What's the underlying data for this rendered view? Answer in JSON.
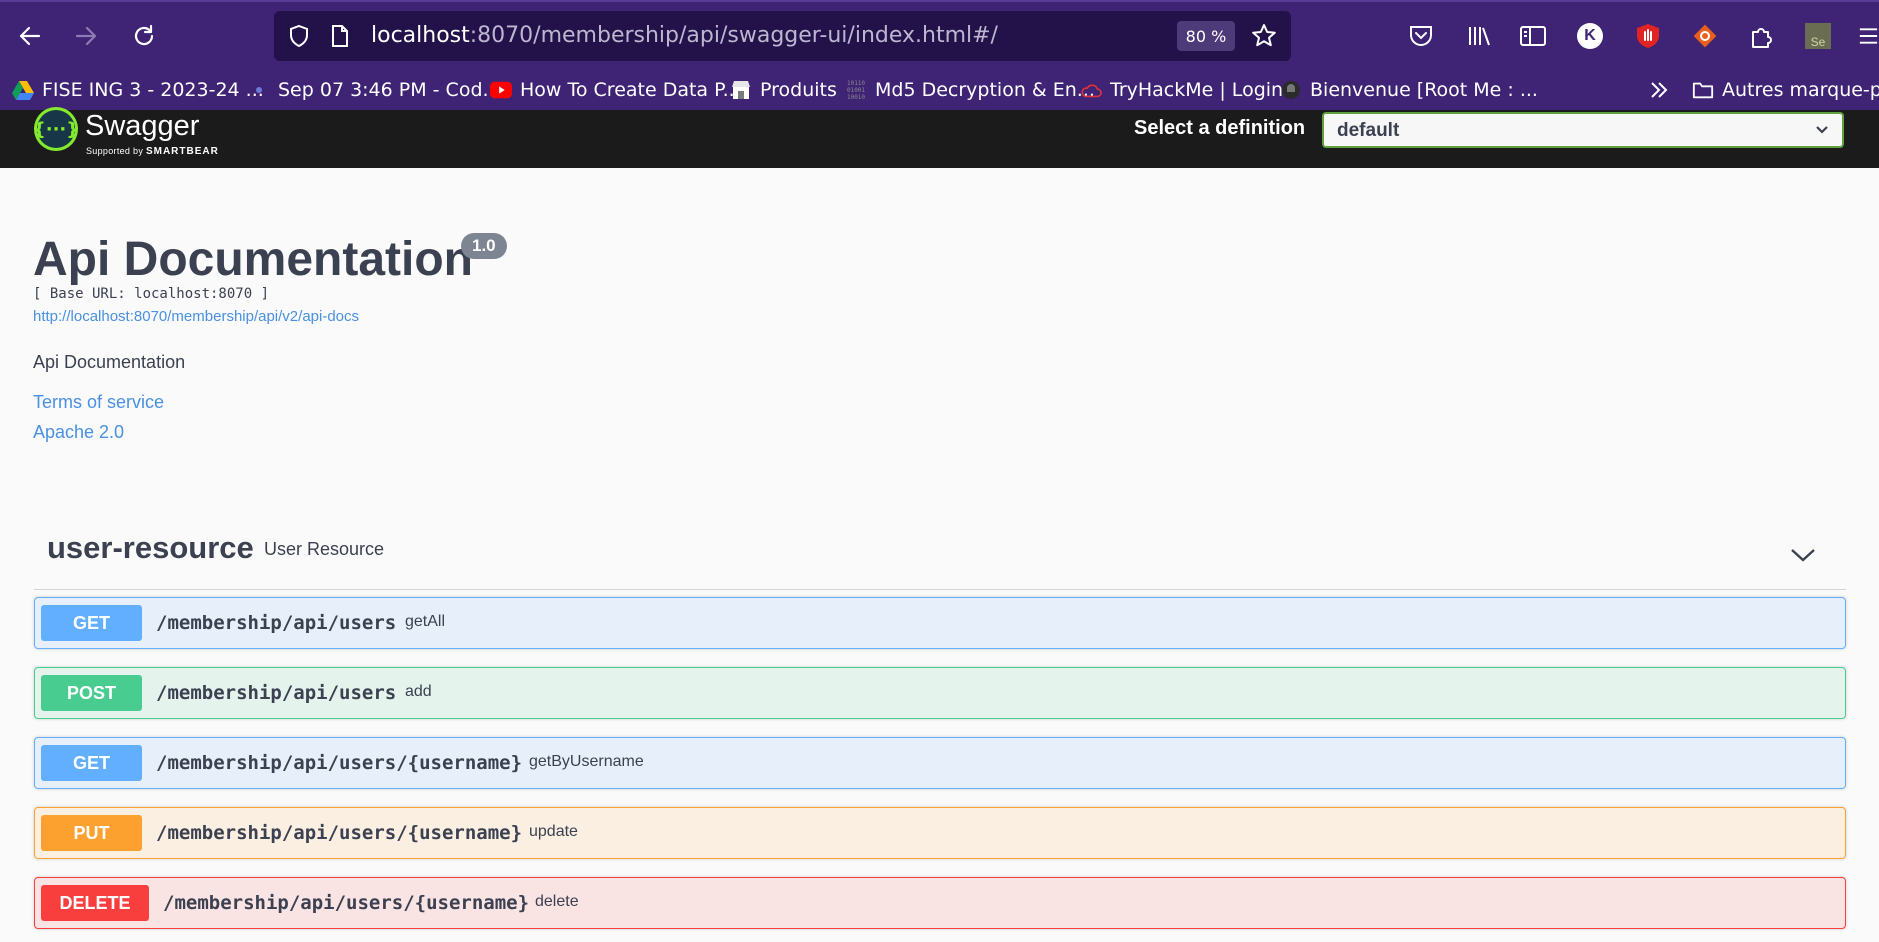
{
  "browser": {
    "url_host": "localhost",
    "url_rest": ":8070/membership/api/swagger-ui/index.html#/",
    "zoom": "80 %",
    "toolbar_icons": [
      "back-icon",
      "forward-icon",
      "reload-icon",
      "shield-icon",
      "page-icon",
      "bookmark-star-icon",
      "pocket-icon",
      "library-icon",
      "sidebar-icon",
      "profile-k-icon",
      "ublock-icon",
      "extension-orange-icon",
      "extensions-icon",
      "selenium-icon",
      "menu-icon"
    ],
    "profile_letter": "K",
    "bookmarks": [
      {
        "label": "FISE ING 3 - 2023-24 ...",
        "icon": "google-drive-icon"
      },
      {
        "label": "Sep 07 3:46 PM - Cod...",
        "icon": "dot-icon"
      },
      {
        "label": "How To Create Data P...",
        "icon": "youtube-icon"
      },
      {
        "label": "Produits",
        "icon": "store-icon"
      },
      {
        "label": "Md5 Decryption & En...",
        "icon": "binary-icon"
      },
      {
        "label": "TryHackMe | Login",
        "icon": "cloud-icon"
      },
      {
        "label": "Bienvenue [Root Me : ...",
        "icon": "rootme-icon"
      }
    ],
    "more_bookmarks": "»",
    "other_bookmarks": "Autres marque-pages"
  },
  "swagger": {
    "logo_name": "Swagger",
    "logo_sub_prefix": "Supported by",
    "logo_sub_brand": "SMARTBEAR",
    "definition_label": "Select a definition",
    "definition_value": "default",
    "accent_green": "#62a03f"
  },
  "info": {
    "title": "Api Documentation",
    "version": "1.0",
    "base_url": "[ Base URL: localhost:8070 ]",
    "api_docs_url": "http://localhost:8070/membership/api/v2/api-docs",
    "description": "Api Documentation",
    "terms": "Terms of service",
    "license": "Apache 2.0"
  },
  "tag": {
    "name": "user-resource",
    "description": "User Resource"
  },
  "operations": [
    {
      "method": "GET",
      "path": "/membership/api/users",
      "summary": "getAll",
      "color": "#61affe"
    },
    {
      "method": "POST",
      "path": "/membership/api/users",
      "summary": "add",
      "color": "#49cc90"
    },
    {
      "method": "GET",
      "path": "/membership/api/users/{username}",
      "summary": "getByUsername",
      "color": "#61affe"
    },
    {
      "method": "PUT",
      "path": "/membership/api/users/{username}",
      "summary": "update",
      "color": "#fca130"
    },
    {
      "method": "DELETE",
      "path": "/membership/api/users/{username}",
      "summary": "delete",
      "color": "#f93e3e"
    }
  ]
}
